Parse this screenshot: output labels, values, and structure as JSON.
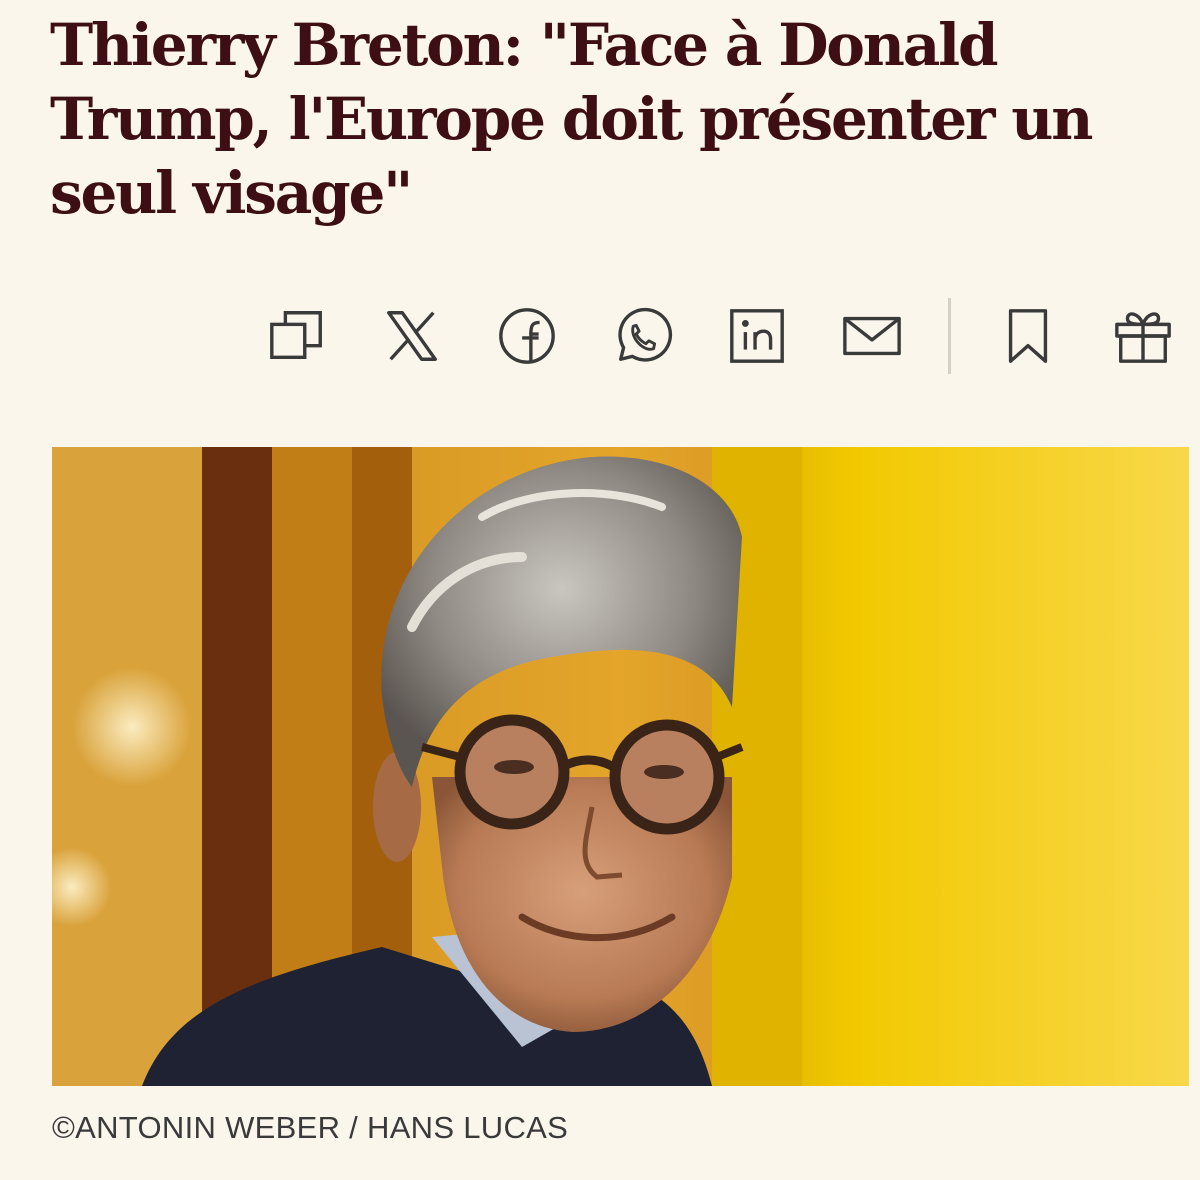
{
  "article": {
    "headline": "Thierry Breton: \"Face à Donald Trump, l'Europe doit présenter un seul visage\"",
    "photo_credit": "©ANTONIN WEBER / HANS LUCAS"
  },
  "share_bar": {
    "icons": [
      "copy-icon",
      "x-icon",
      "facebook-icon",
      "whatsapp-icon",
      "linkedin-icon",
      "mail-icon",
      "bookmark-icon",
      "gift-icon"
    ]
  },
  "colors": {
    "background": "#fbf6ec",
    "headline": "#3d0f14",
    "icon": "#3a3a3a",
    "accent_yellow": "#f2c400"
  }
}
